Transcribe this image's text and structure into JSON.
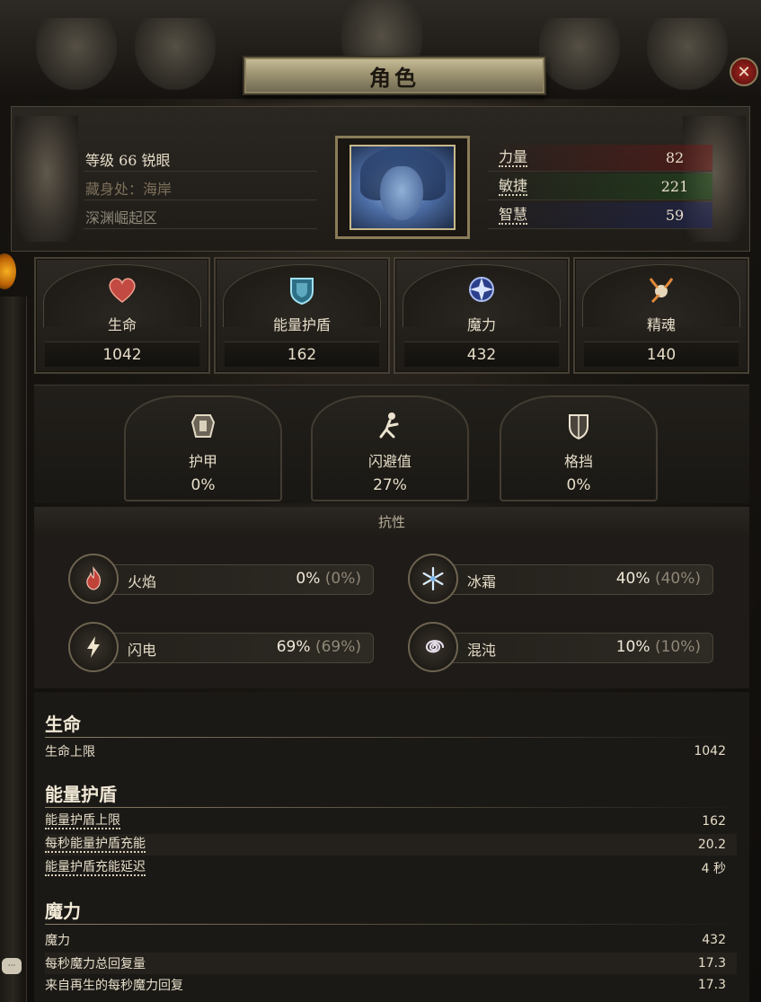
{
  "window": {
    "title": "角色",
    "close_icon": "close-icon"
  },
  "character": {
    "level_line": "等级 66 锐眼",
    "hideout": "藏身处：海岸",
    "area": "深渊崛起区"
  },
  "attributes": [
    {
      "label": "力量",
      "value": "82",
      "color": "#7a1a1a"
    },
    {
      "label": "敏捷",
      "value": "221",
      "color": "#1e5a1e"
    },
    {
      "label": "智慧",
      "value": "59",
      "color": "#1e2870"
    }
  ],
  "stats": [
    {
      "label": "生命",
      "value": "1042",
      "icon": "heart-icon"
    },
    {
      "label": "能量护盾",
      "value": "162",
      "icon": "energy-shield-icon"
    },
    {
      "label": "魔力",
      "value": "432",
      "icon": "mana-icon"
    },
    {
      "label": "精魂",
      "value": "140",
      "icon": "spirit-icon"
    }
  ],
  "defenses": [
    {
      "label": "护甲",
      "value": "0%",
      "icon": "armour-icon"
    },
    {
      "label": "闪避值",
      "value": "27%",
      "icon": "evasion-icon"
    },
    {
      "label": "格挡",
      "value": "0%",
      "icon": "block-icon"
    }
  ],
  "resistances": {
    "title": "抗性",
    "items": [
      {
        "label": "火焰",
        "value": "0%",
        "cap": "(0%)",
        "icon": "fire-icon"
      },
      {
        "label": "冰霜",
        "value": "40%",
        "cap": "(40%)",
        "icon": "cold-icon"
      },
      {
        "label": "闪电",
        "value": "69%",
        "cap": "(69%)",
        "icon": "lightning-icon"
      },
      {
        "label": "混沌",
        "value": "10%",
        "cap": "(10%)",
        "icon": "chaos-icon"
      }
    ]
  },
  "details": {
    "life": {
      "title": "生命",
      "rows": [
        {
          "label": "生命上限",
          "value": "1042"
        }
      ]
    },
    "energy_shield": {
      "title": "能量护盾",
      "rows": [
        {
          "label": "能量护盾上限",
          "value": "162"
        },
        {
          "label": "每秒能量护盾充能",
          "value": "20.2"
        },
        {
          "label": "能量护盾充能延迟",
          "value": "4 秒"
        }
      ]
    },
    "mana": {
      "title": "魔力",
      "rows": [
        {
          "label": "魔力",
          "value": "432"
        },
        {
          "label": "每秒魔力总回复量",
          "value": "17.3"
        },
        {
          "label": "来自再生的每秒魔力回复",
          "value": "17.3"
        }
      ]
    }
  }
}
